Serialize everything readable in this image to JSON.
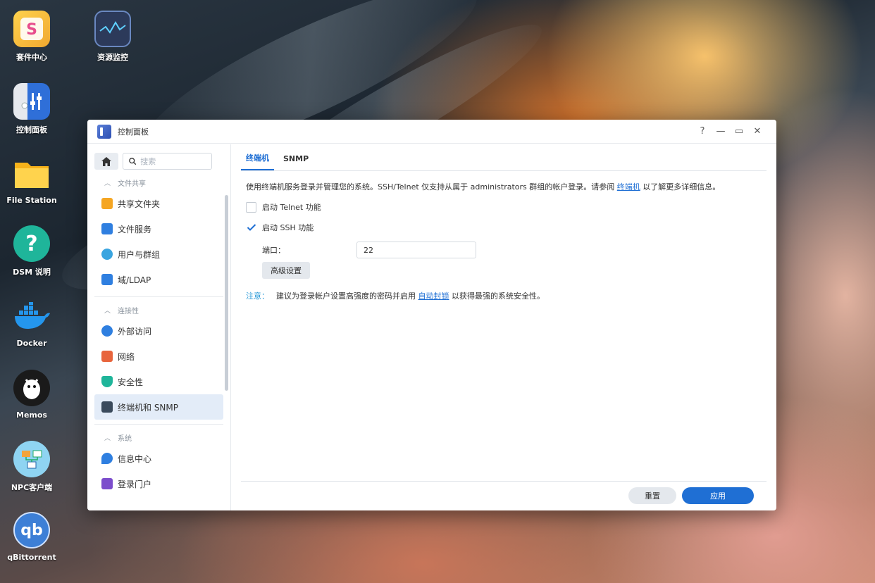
{
  "desktop": {
    "icons": [
      {
        "label": "套件中心",
        "icon": "package-center-icon"
      },
      {
        "label": "资源监控",
        "icon": "resource-monitor-icon"
      },
      {
        "label": "控制面板",
        "icon": "control-panel-icon"
      },
      {
        "label": "File Station",
        "icon": "folder-icon"
      },
      {
        "label": "DSM 说明",
        "icon": "help-icon"
      },
      {
        "label": "Docker",
        "icon": "docker-icon"
      },
      {
        "label": "Memos",
        "icon": "memos-icon"
      },
      {
        "label": "NPC客户端",
        "icon": "network-client-icon"
      },
      {
        "label": "qBittorrent",
        "icon": "qbittorrent-icon"
      }
    ]
  },
  "window": {
    "title": "控制面板",
    "controls": {
      "help": "?",
      "minimize": "—",
      "maximize": "▭",
      "close": "✕"
    }
  },
  "sidebar": {
    "search_placeholder": "搜索",
    "sections": [
      {
        "label": "文件共享",
        "items": [
          {
            "label": "共享文件夹",
            "color": "#f5a623"
          },
          {
            "label": "文件服务",
            "color": "#2f7fe0"
          },
          {
            "label": "用户与群组",
            "color": "#3aa5e0"
          },
          {
            "label": "域/LDAP",
            "color": "#2f7fe0"
          }
        ]
      },
      {
        "label": "连接性",
        "items": [
          {
            "label": "外部访问",
            "color": "#2f7fe0"
          },
          {
            "label": "网络",
            "color": "#e8643c"
          },
          {
            "label": "安全性",
            "color": "#1fb59a"
          },
          {
            "label": "终端机和 SNMP",
            "color": "#3a4a5c",
            "active": true
          }
        ]
      },
      {
        "label": "系统",
        "items": [
          {
            "label": "信息中心",
            "color": "#2f7fe0"
          },
          {
            "label": "登录门户",
            "color": "#7c4dcc"
          }
        ]
      }
    ]
  },
  "main": {
    "tabs": [
      {
        "label": "终端机",
        "active": true
      },
      {
        "label": "SNMP"
      }
    ],
    "description_prefix": "使用终端机服务登录并管理您的系统。SSH/Telnet 仅支持从属于 administrators 群组的帐户登录。请参阅 ",
    "description_link": "终端机",
    "description_suffix": " 以了解更多详细信息。",
    "telnet_label": "启动 Telnet 功能",
    "telnet_checked": false,
    "ssh_label": "启动 SSH 功能",
    "ssh_checked": true,
    "port_label": "端口：",
    "port_value": "22",
    "advanced_button": "高级设置",
    "note_label": "注意：",
    "note_prefix": "建议为登录帐户设置高强度的密码并启用 ",
    "note_link": "自动封锁",
    "note_suffix": " 以获得最强的系统安全性。"
  },
  "footer": {
    "reset_label": "重置",
    "apply_label": "应用"
  },
  "colors": {
    "accent": "#1f6fd4",
    "active_bg": "#e3ecf8",
    "note": "#2b9bd8"
  }
}
